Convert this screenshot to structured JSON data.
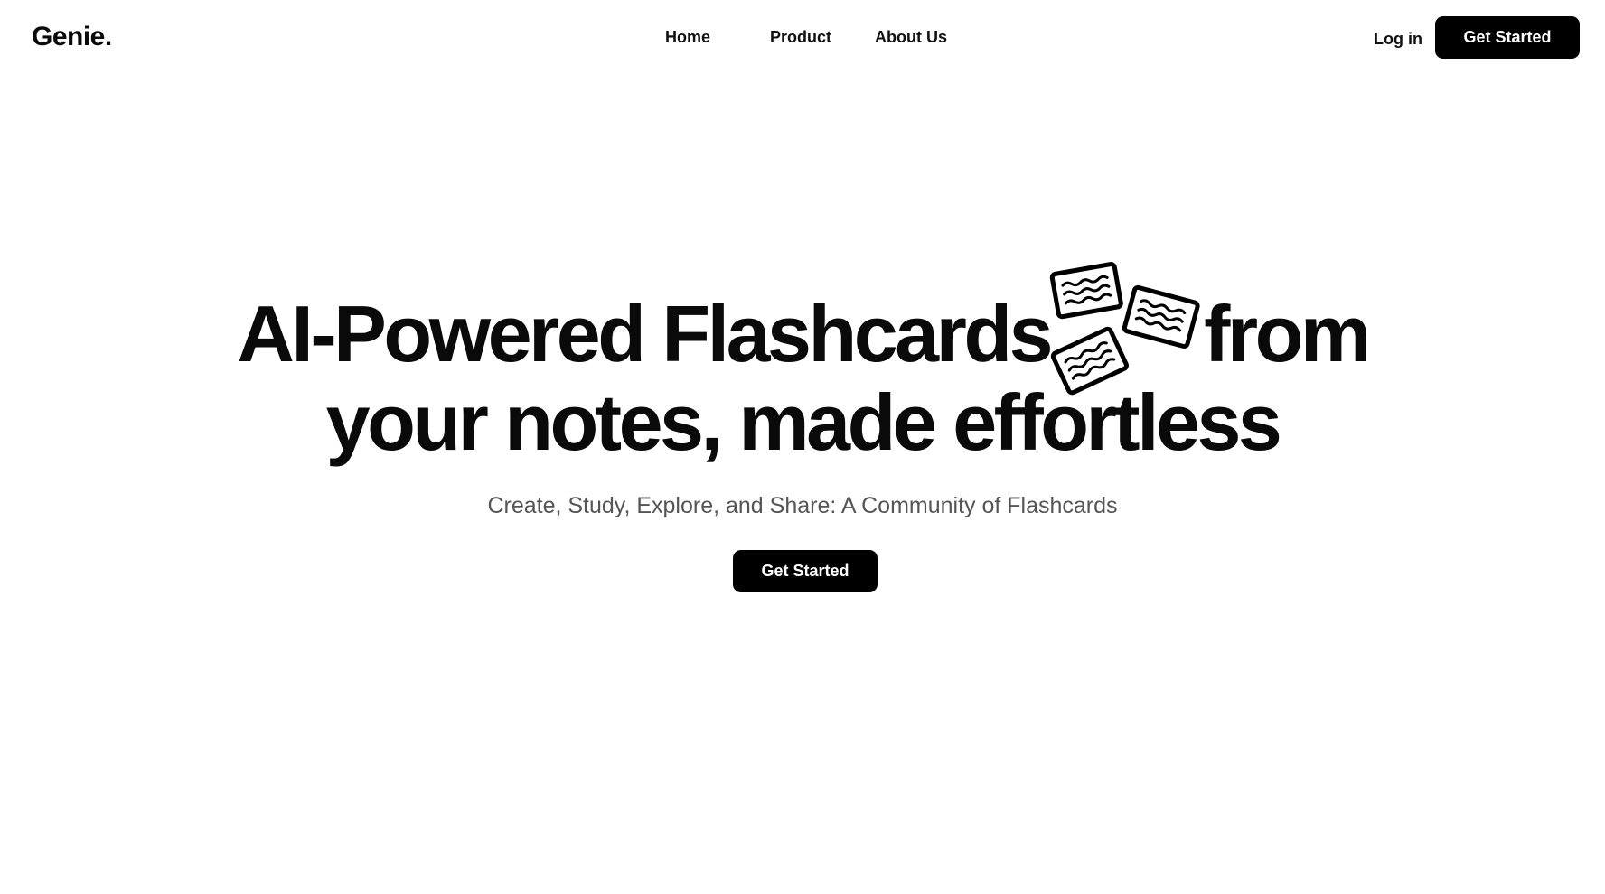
{
  "brand": {
    "logo": "Genie."
  },
  "nav": {
    "links": [
      "Home",
      "Product",
      "About Us"
    ],
    "login": "Log in",
    "cta": "Get Started"
  },
  "hero": {
    "headline_part1": "AI-Powered Flashcards",
    "headline_part2": "from",
    "headline_line2": "your notes, made effortless",
    "subtitle": "Create, Study, Explore, and Share: A Community of Flashcards",
    "cta": "Get Started",
    "illustration": "flashcards-icon"
  },
  "colors": {
    "background": "#ffffff",
    "text": "#0a0a0a",
    "subtitle": "#555555",
    "button_bg": "#000000",
    "button_text": "#ffffff"
  }
}
